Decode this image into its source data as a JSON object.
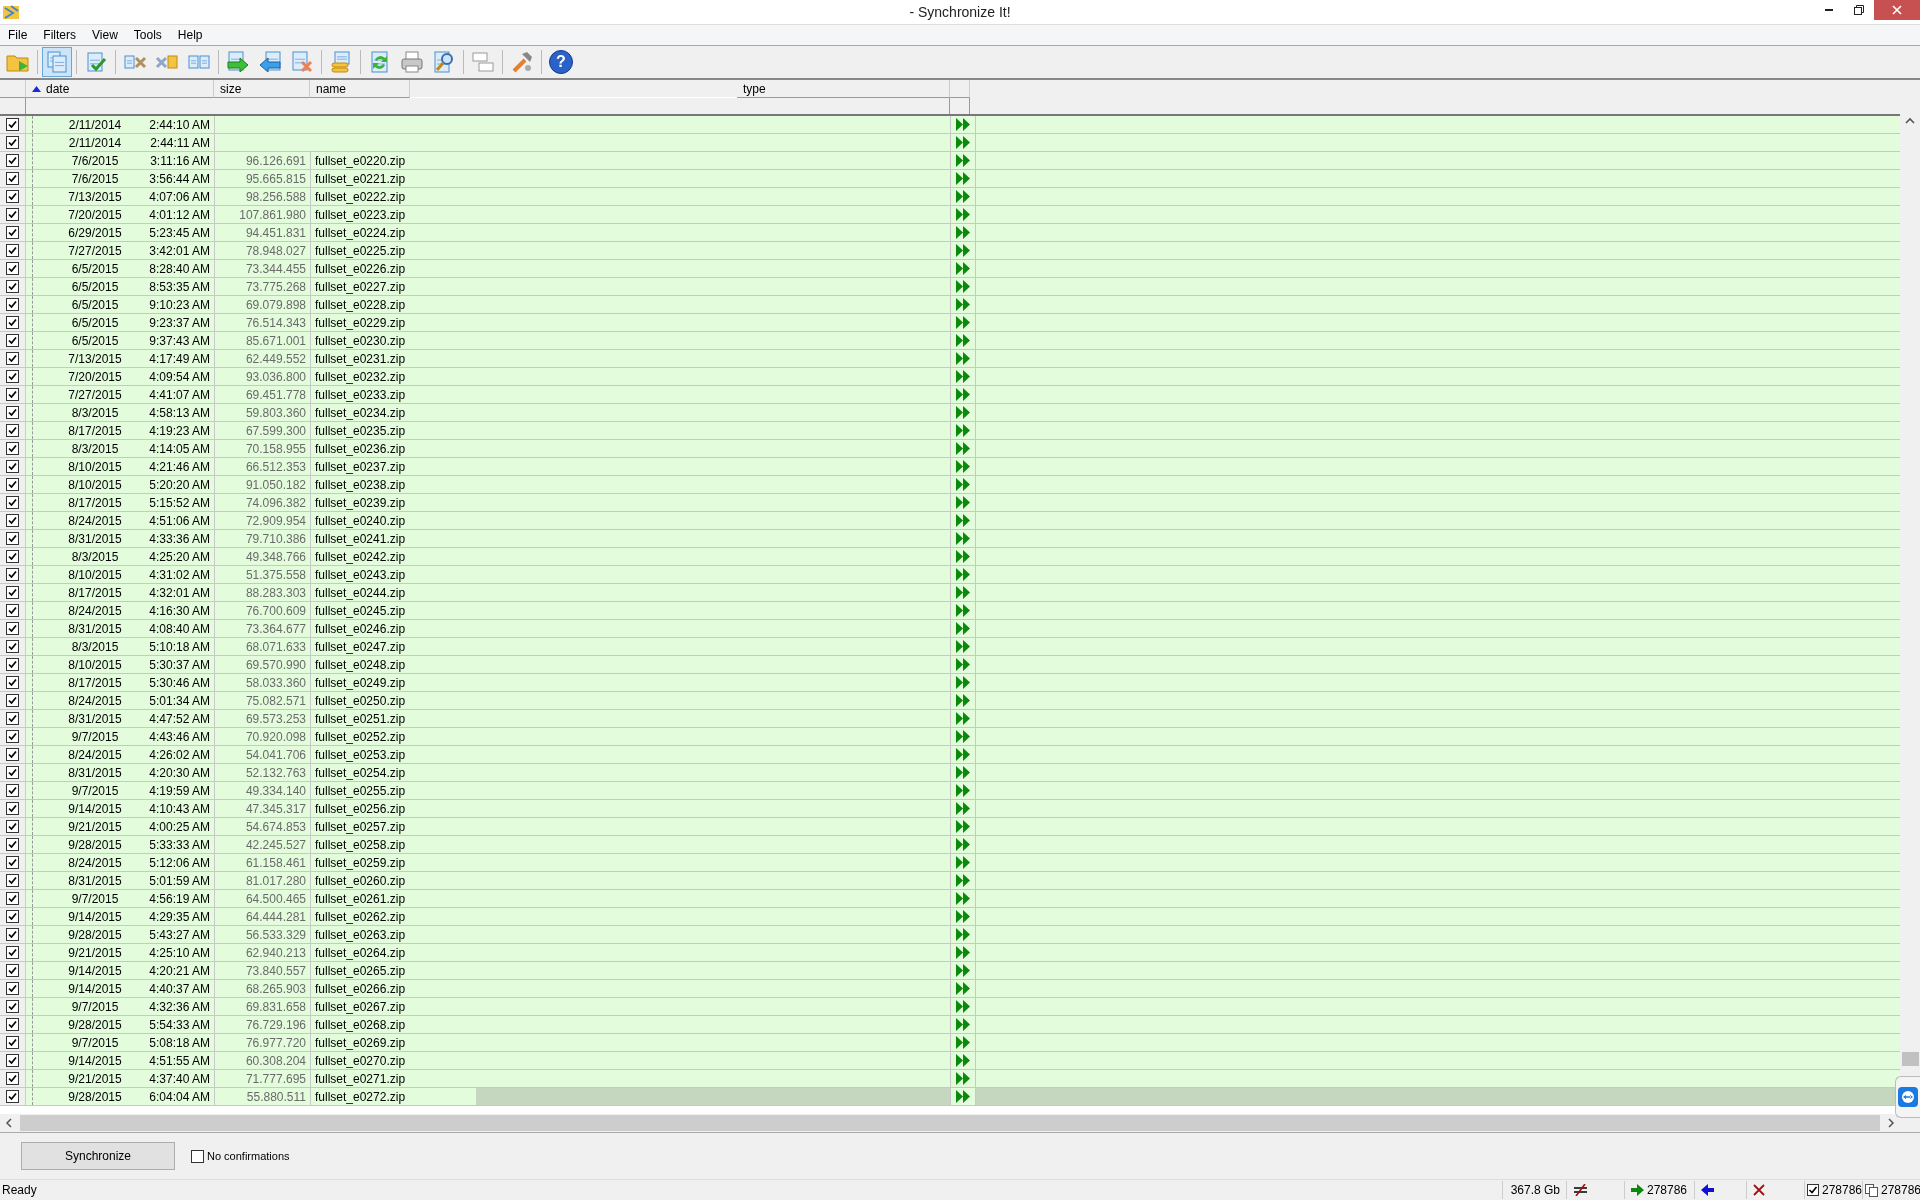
{
  "window": {
    "title": "- Synchronize It!"
  },
  "menu": [
    "File",
    "Filters",
    "View",
    "Tools",
    "Help"
  ],
  "toolbar": [
    [
      {
        "kind": "folder",
        "selected": false
      }
    ],
    [
      {
        "kind": "pages",
        "selected": true
      }
    ],
    [
      {
        "kind": "check-pages",
        "selected": false
      }
    ],
    [
      {
        "kind": "delete-left",
        "selected": false
      },
      {
        "kind": "delete-right",
        "selected": false
      },
      {
        "kind": "pages-pair",
        "selected": false
      }
    ],
    [
      {
        "kind": "copy-right",
        "selected": false
      },
      {
        "kind": "copy-left",
        "selected": false
      },
      {
        "kind": "page-x",
        "selected": false
      }
    ],
    [
      {
        "kind": "stack",
        "selected": false
      }
    ],
    [
      {
        "kind": "refresh",
        "selected": false
      },
      {
        "kind": "print",
        "selected": false
      },
      {
        "kind": "preview",
        "selected": false
      }
    ],
    [
      {
        "kind": "compare",
        "selected": false
      }
    ],
    [
      {
        "kind": "tools",
        "selected": false
      }
    ],
    [
      {
        "kind": "help",
        "selected": false,
        "glyph": "?"
      }
    ]
  ],
  "table": {
    "columns": [
      {
        "label": "date",
        "sorted": true
      },
      {
        "label": "size",
        "sorted": false
      },
      {
        "label": "name",
        "sorted": false
      },
      {
        "label": "type",
        "sorted": false
      }
    ],
    "rows": [
      {
        "checked": true,
        "date": "2/11/2014",
        "time": "2:44:10 AM",
        "kind": "copy-right",
        "selected": false
      },
      {
        "checked": true,
        "date": "2/11/2014",
        "time": "2:44:11 AM",
        "kind": "copy-right",
        "selected": false
      },
      {
        "checked": true,
        "date": "7/6/2015",
        "time": "3:11:16 AM",
        "size": "96.126.691",
        "name": "fullset_e0220.zip",
        "kind": "copy-right",
        "selected": false
      },
      {
        "checked": true,
        "date": "7/6/2015",
        "time": "3:56:44 AM",
        "size": "95.665.815",
        "name": "fullset_e0221.zip",
        "kind": "copy-right",
        "selected": false
      },
      {
        "checked": true,
        "date": "7/13/2015",
        "time": "4:07:06 AM",
        "size": "98.256.588",
        "name": "fullset_e0222.zip",
        "kind": "copy-right",
        "selected": false
      },
      {
        "checked": true,
        "date": "7/20/2015",
        "time": "4:01:12 AM",
        "size": "107.861.980",
        "name": "fullset_e0223.zip",
        "kind": "copy-right",
        "selected": false
      },
      {
        "checked": true,
        "date": "6/29/2015",
        "time": "5:23:45 AM",
        "size": "94.451.831",
        "name": "fullset_e0224.zip",
        "kind": "copy-right",
        "selected": false
      },
      {
        "checked": true,
        "date": "7/27/2015",
        "time": "3:42:01 AM",
        "size": "78.948.027",
        "name": "fullset_e0225.zip",
        "kind": "copy-right",
        "selected": false
      },
      {
        "checked": true,
        "date": "6/5/2015",
        "time": "8:28:40 AM",
        "size": "73.344.455",
        "name": "fullset_e0226.zip",
        "kind": "copy-right",
        "selected": false
      },
      {
        "checked": true,
        "date": "6/5/2015",
        "time": "8:53:35 AM",
        "size": "73.775.268",
        "name": "fullset_e0227.zip",
        "kind": "copy-right",
        "selected": false
      },
      {
        "checked": true,
        "date": "6/5/2015",
        "time": "9:10:23 AM",
        "size": "69.079.898",
        "name": "fullset_e0228.zip",
        "kind": "copy-right",
        "selected": false
      },
      {
        "checked": true,
        "date": "6/5/2015",
        "time": "9:23:37 AM",
        "size": "76.514.343",
        "name": "fullset_e0229.zip",
        "kind": "copy-right",
        "selected": false
      },
      {
        "checked": true,
        "date": "6/5/2015",
        "time": "9:37:43 AM",
        "size": "85.671.001",
        "name": "fullset_e0230.zip",
        "kind": "copy-right",
        "selected": false
      },
      {
        "checked": true,
        "date": "7/13/2015",
        "time": "4:17:49 AM",
        "size": "62.449.552",
        "name": "fullset_e0231.zip",
        "kind": "copy-right",
        "selected": false
      },
      {
        "checked": true,
        "date": "7/20/2015",
        "time": "4:09:54 AM",
        "size": "93.036.800",
        "name": "fullset_e0232.zip",
        "kind": "copy-right",
        "selected": false
      },
      {
        "checked": true,
        "date": "7/27/2015",
        "time": "4:41:07 AM",
        "size": "69.451.778",
        "name": "fullset_e0233.zip",
        "kind": "copy-right",
        "selected": false
      },
      {
        "checked": true,
        "date": "8/3/2015",
        "time": "4:58:13 AM",
        "size": "59.803.360",
        "name": "fullset_e0234.zip",
        "kind": "copy-right",
        "selected": false
      },
      {
        "checked": true,
        "date": "8/17/2015",
        "time": "4:19:23 AM",
        "size": "67.599.300",
        "name": "fullset_e0235.zip",
        "kind": "copy-right",
        "selected": false
      },
      {
        "checked": true,
        "date": "8/3/2015",
        "time": "4:14:05 AM",
        "size": "70.158.955",
        "name": "fullset_e0236.zip",
        "kind": "copy-right",
        "selected": false
      },
      {
        "checked": true,
        "date": "8/10/2015",
        "time": "4:21:46 AM",
        "size": "66.512.353",
        "name": "fullset_e0237.zip",
        "kind": "copy-right",
        "selected": false
      },
      {
        "checked": true,
        "date": "8/10/2015",
        "time": "5:20:20 AM",
        "size": "91.050.182",
        "name": "fullset_e0238.zip",
        "kind": "copy-right",
        "selected": false
      },
      {
        "checked": true,
        "date": "8/17/2015",
        "time": "5:15:52 AM",
        "size": "74.096.382",
        "name": "fullset_e0239.zip",
        "kind": "copy-right",
        "selected": false
      },
      {
        "checked": true,
        "date": "8/24/2015",
        "time": "4:51:06 AM",
        "size": "72.909.954",
        "name": "fullset_e0240.zip",
        "kind": "copy-right",
        "selected": false
      },
      {
        "checked": true,
        "date": "8/31/2015",
        "time": "4:33:36 AM",
        "size": "79.710.386",
        "name": "fullset_e0241.zip",
        "kind": "copy-right",
        "selected": false
      },
      {
        "checked": true,
        "date": "8/3/2015",
        "time": "4:25:20 AM",
        "size": "49.348.766",
        "name": "fullset_e0242.zip",
        "kind": "copy-right",
        "selected": false
      },
      {
        "checked": true,
        "date": "8/10/2015",
        "time": "4:31:02 AM",
        "size": "51.375.558",
        "name": "fullset_e0243.zip",
        "kind": "copy-right",
        "selected": false
      },
      {
        "checked": true,
        "date": "8/17/2015",
        "time": "4:32:01 AM",
        "size": "88.283.303",
        "name": "fullset_e0244.zip",
        "kind": "copy-right",
        "selected": false
      },
      {
        "checked": true,
        "date": "8/24/2015",
        "time": "4:16:30 AM",
        "size": "76.700.609",
        "name": "fullset_e0245.zip",
        "kind": "copy-right",
        "selected": false
      },
      {
        "checked": true,
        "date": "8/31/2015",
        "time": "4:08:40 AM",
        "size": "73.364.677",
        "name": "fullset_e0246.zip",
        "kind": "copy-right",
        "selected": false
      },
      {
        "checked": true,
        "date": "8/3/2015",
        "time": "5:10:18 AM",
        "size": "68.071.633",
        "name": "fullset_e0247.zip",
        "kind": "copy-right",
        "selected": false
      },
      {
        "checked": true,
        "date": "8/10/2015",
        "time": "5:30:37 AM",
        "size": "69.570.990",
        "name": "fullset_e0248.zip",
        "kind": "copy-right",
        "selected": false
      },
      {
        "checked": true,
        "date": "8/17/2015",
        "time": "5:30:46 AM",
        "size": "58.033.360",
        "name": "fullset_e0249.zip",
        "kind": "copy-right",
        "selected": false
      },
      {
        "checked": true,
        "date": "8/24/2015",
        "time": "5:01:34 AM",
        "size": "75.082.571",
        "name": "fullset_e0250.zip",
        "kind": "copy-right",
        "selected": false
      },
      {
        "checked": true,
        "date": "8/31/2015",
        "time": "4:47:52 AM",
        "size": "69.573.253",
        "name": "fullset_e0251.zip",
        "kind": "copy-right",
        "selected": false
      },
      {
        "checked": true,
        "date": "9/7/2015",
        "time": "4:43:46 AM",
        "size": "70.920.098",
        "name": "fullset_e0252.zip",
        "kind": "copy-right",
        "selected": false
      },
      {
        "checked": true,
        "date": "8/24/2015",
        "time": "4:26:02 AM",
        "size": "54.041.706",
        "name": "fullset_e0253.zip",
        "kind": "copy-right",
        "selected": false
      },
      {
        "checked": true,
        "date": "8/31/2015",
        "time": "4:20:30 AM",
        "size": "52.132.763",
        "name": "fullset_e0254.zip",
        "kind": "copy-right",
        "selected": false
      },
      {
        "checked": true,
        "date": "9/7/2015",
        "time": "4:19:59 AM",
        "size": "49.334.140",
        "name": "fullset_e0255.zip",
        "kind": "copy-right",
        "selected": false
      },
      {
        "checked": true,
        "date": "9/14/2015",
        "time": "4:10:43 AM",
        "size": "47.345.317",
        "name": "fullset_e0256.zip",
        "kind": "copy-right",
        "selected": false
      },
      {
        "checked": true,
        "date": "9/21/2015",
        "time": "4:00:25 AM",
        "size": "54.674.853",
        "name": "fullset_e0257.zip",
        "kind": "copy-right",
        "selected": false
      },
      {
        "checked": true,
        "date": "9/28/2015",
        "time": "5:33:33 AM",
        "size": "42.245.527",
        "name": "fullset_e0258.zip",
        "kind": "copy-right",
        "selected": false
      },
      {
        "checked": true,
        "date": "8/24/2015",
        "time": "5:12:06 AM",
        "size": "61.158.461",
        "name": "fullset_e0259.zip",
        "kind": "copy-right",
        "selected": false
      },
      {
        "checked": true,
        "date": "8/31/2015",
        "time": "5:01:59 AM",
        "size": "81.017.280",
        "name": "fullset_e0260.zip",
        "kind": "copy-right",
        "selected": false
      },
      {
        "checked": true,
        "date": "9/7/2015",
        "time": "4:56:19 AM",
        "size": "64.500.465",
        "name": "fullset_e0261.zip",
        "kind": "copy-right",
        "selected": false
      },
      {
        "checked": true,
        "date": "9/14/2015",
        "time": "4:29:35 AM",
        "size": "64.444.281",
        "name": "fullset_e0262.zip",
        "kind": "copy-right",
        "selected": false
      },
      {
        "checked": true,
        "date": "9/28/2015",
        "time": "5:43:27 AM",
        "size": "56.533.329",
        "name": "fullset_e0263.zip",
        "kind": "copy-right",
        "selected": false
      },
      {
        "checked": true,
        "date": "9/21/2015",
        "time": "4:25:10 AM",
        "size": "62.940.213",
        "name": "fullset_e0264.zip",
        "kind": "copy-right",
        "selected": false
      },
      {
        "checked": true,
        "date": "9/14/2015",
        "time": "4:20:21 AM",
        "size": "73.840.557",
        "name": "fullset_e0265.zip",
        "kind": "copy-right",
        "selected": false
      },
      {
        "checked": true,
        "date": "9/14/2015",
        "time": "4:40:37 AM",
        "size": "68.265.903",
        "name": "fullset_e0266.zip",
        "kind": "copy-right",
        "selected": false
      },
      {
        "checked": true,
        "date": "9/7/2015",
        "time": "4:32:36 AM",
        "size": "69.831.658",
        "name": "fullset_e0267.zip",
        "kind": "copy-right",
        "selected": false
      },
      {
        "checked": true,
        "date": "9/28/2015",
        "time": "5:54:33 AM",
        "size": "76.729.196",
        "name": "fullset_e0268.zip",
        "kind": "copy-right",
        "selected": false
      },
      {
        "checked": true,
        "date": "9/7/2015",
        "time": "5:08:18 AM",
        "size": "76.977.720",
        "name": "fullset_e0269.zip",
        "kind": "copy-right",
        "selected": false
      },
      {
        "checked": true,
        "date": "9/14/2015",
        "time": "4:51:55 AM",
        "size": "60.308.204",
        "name": "fullset_e0270.zip",
        "kind": "copy-right",
        "selected": false
      },
      {
        "checked": true,
        "date": "9/21/2015",
        "time": "4:37:40 AM",
        "size": "71.777.695",
        "name": "fullset_e0271.zip",
        "kind": "copy-right",
        "selected": false
      },
      {
        "checked": true,
        "date": "9/28/2015",
        "time": "6:04:04 AM",
        "size": "55.880.511",
        "name": "fullset_e0272.zip",
        "kind": "copy-right",
        "selected": true
      }
    ]
  },
  "bottom": {
    "sync_button": "Synchronize",
    "no_confirmations": {
      "label": "No confirmations",
      "checked": false
    }
  },
  "status_bar": {
    "text": "Ready",
    "total_size": "367.8 Gb",
    "copy_right_count": "278786",
    "checked_count": "278786",
    "file_count": "278786"
  }
}
